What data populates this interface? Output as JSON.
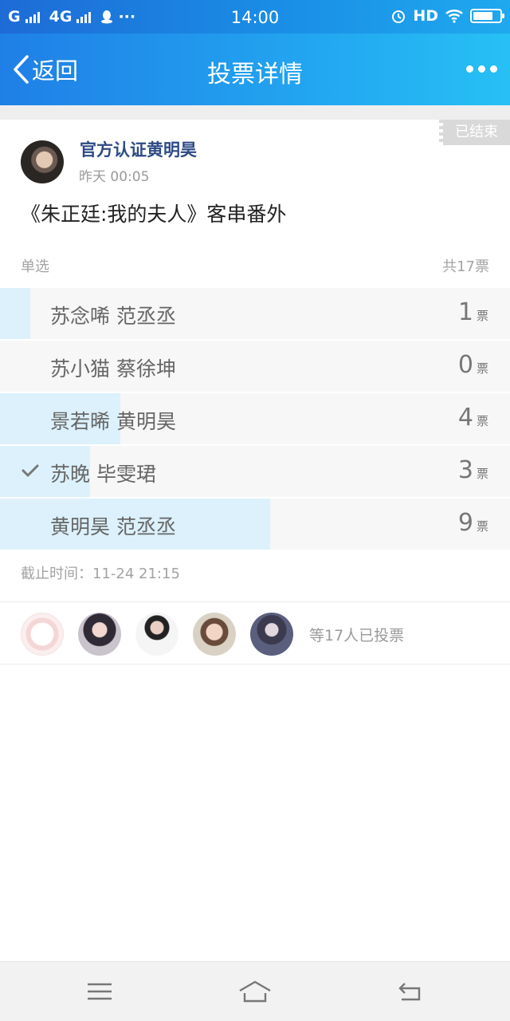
{
  "status_bar": {
    "carrier1": "G",
    "carrier2": "4G",
    "more": "···",
    "time": "14:00",
    "hd": "HD"
  },
  "nav": {
    "back_label": "返回",
    "title": "投票详情"
  },
  "post": {
    "badge": "已结束",
    "author": "官方认证黄明昊",
    "time": "昨天 00:05",
    "title": "《朱正廷:我的夫人》客串番外",
    "mode": "单选",
    "total": "共17票",
    "deadline": "截止时间：11-24 21:15"
  },
  "options": [
    {
      "label": "苏念唏 范丞丞",
      "count": "1",
      "unit": "票",
      "share": 0.0588,
      "selected": false
    },
    {
      "label": "苏小猫 蔡徐坤",
      "count": "0",
      "unit": "票",
      "share": 0.0,
      "selected": false
    },
    {
      "label": "景若晞 黄明昊",
      "count": "4",
      "unit": "票",
      "share": 0.2353,
      "selected": false
    },
    {
      "label": "苏晚 毕雯珺",
      "count": "3",
      "unit": "票",
      "share": 0.1765,
      "selected": true
    },
    {
      "label": "黄明昊 范丞丞",
      "count": "9",
      "unit": "票",
      "share": 0.5294,
      "selected": false
    }
  ],
  "voters": {
    "text": "等17人已投票"
  },
  "colors": {
    "brand": "#1f9ef0",
    "author": "#2d4a86",
    "fill": "#dcf1fb"
  }
}
